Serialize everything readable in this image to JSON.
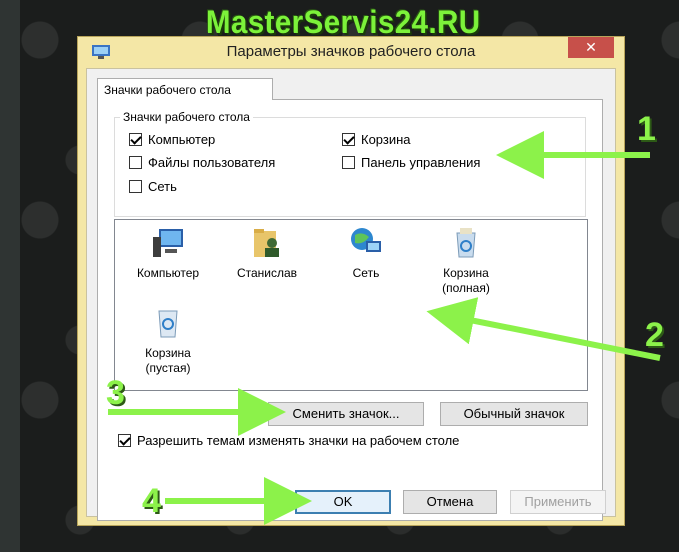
{
  "watermark": "MasterServis24.RU",
  "dialog": {
    "title": "Параметры значков рабочего стола",
    "close_label": "✕",
    "tab_label": "Значки рабочего стола",
    "group_label": "Значки рабочего стола",
    "checkboxes": [
      {
        "label": "Компьютер",
        "checked": true
      },
      {
        "label": "Корзина",
        "checked": true
      },
      {
        "label": "Файлы пользователя",
        "checked": false
      },
      {
        "label": "Панель управления",
        "checked": false
      },
      {
        "label": "Сеть",
        "checked": false
      }
    ],
    "icons": [
      {
        "label": "Компьютер",
        "icon": "computer-icon"
      },
      {
        "label": "Станислав",
        "icon": "user-folder-icon"
      },
      {
        "label": "Сеть",
        "icon": "network-icon"
      },
      {
        "label": "Корзина\n(полная)",
        "icon": "recycle-bin-full-icon"
      },
      {
        "label": "Корзина\n(пустая)",
        "icon": "recycle-bin-empty-icon"
      }
    ],
    "change_icon_label": "Сменить значок...",
    "default_icon_label": "Обычный значок",
    "allow_themes_label": "Разрешить темам изменять значки на рабочем столе",
    "allow_themes_checked": true,
    "ok_label": "OK",
    "cancel_label": "Отмена",
    "apply_label": "Применить"
  },
  "annotations": {
    "numbers": [
      "1",
      "2",
      "3",
      "4"
    ],
    "arrow_color": "#8cf24a"
  }
}
